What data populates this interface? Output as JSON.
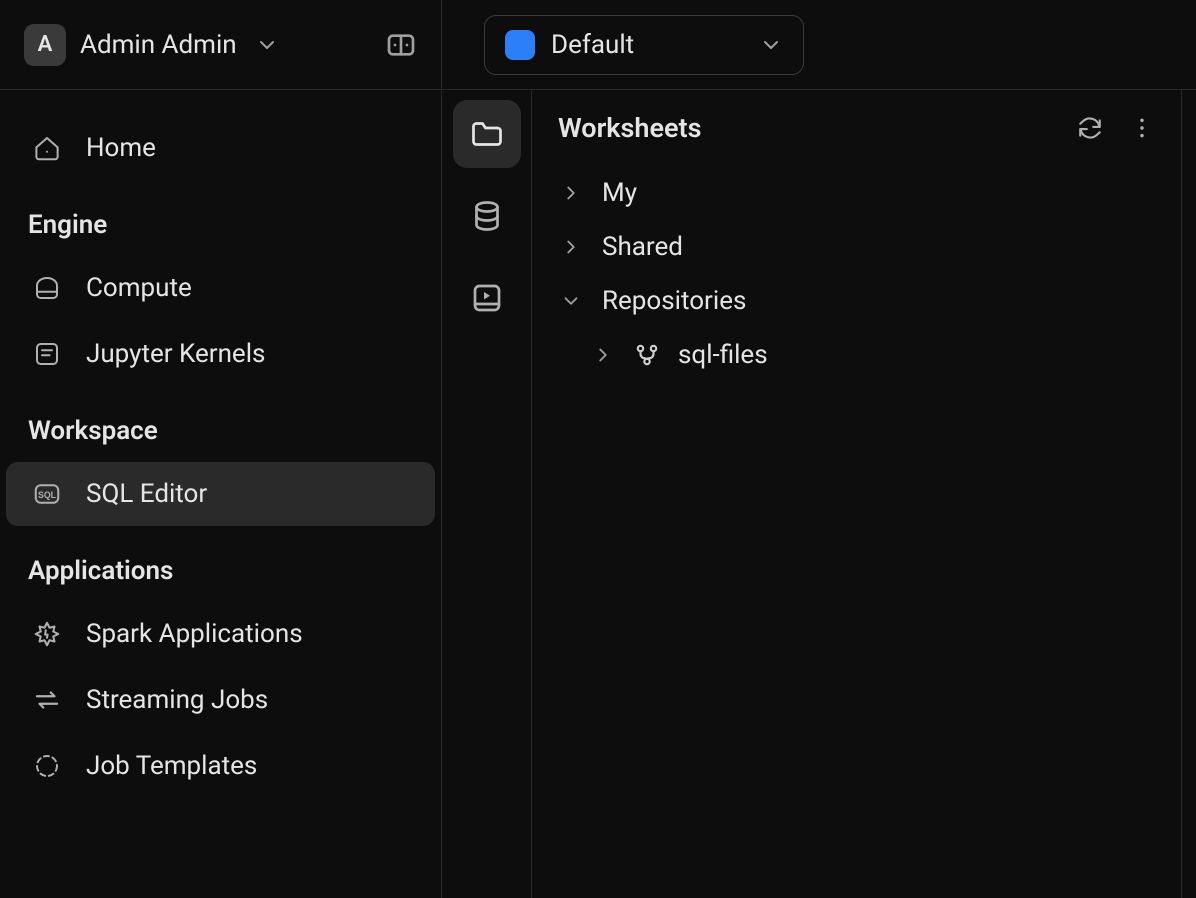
{
  "user": {
    "initial": "A",
    "name": "Admin Admin"
  },
  "project": {
    "name": "Default",
    "color": "#2d7ff9"
  },
  "sidebar": {
    "home": "Home",
    "sections": {
      "engine": {
        "title": "Engine",
        "items": [
          {
            "label": "Compute",
            "icon": "compute-icon"
          },
          {
            "label": "Jupyter Kernels",
            "icon": "jupyter-icon"
          }
        ]
      },
      "workspace": {
        "title": "Workspace",
        "items": [
          {
            "label": "SQL Editor",
            "icon": "sql-icon",
            "active": true
          }
        ]
      },
      "applications": {
        "title": "Applications",
        "items": [
          {
            "label": "Spark Applications",
            "icon": "spark-icon"
          },
          {
            "label": "Streaming Jobs",
            "icon": "streaming-icon"
          },
          {
            "label": "Job Templates",
            "icon": "templates-icon"
          }
        ]
      }
    }
  },
  "rail": {
    "items": [
      {
        "name": "folder-icon",
        "active": true
      },
      {
        "name": "database-icon",
        "active": false
      },
      {
        "name": "book-icon",
        "active": false
      }
    ]
  },
  "panel": {
    "title": "Worksheets",
    "tree": {
      "my": "My",
      "shared": "Shared",
      "repositories": "Repositories",
      "repo_items": [
        {
          "label": "sql-files"
        }
      ]
    }
  }
}
